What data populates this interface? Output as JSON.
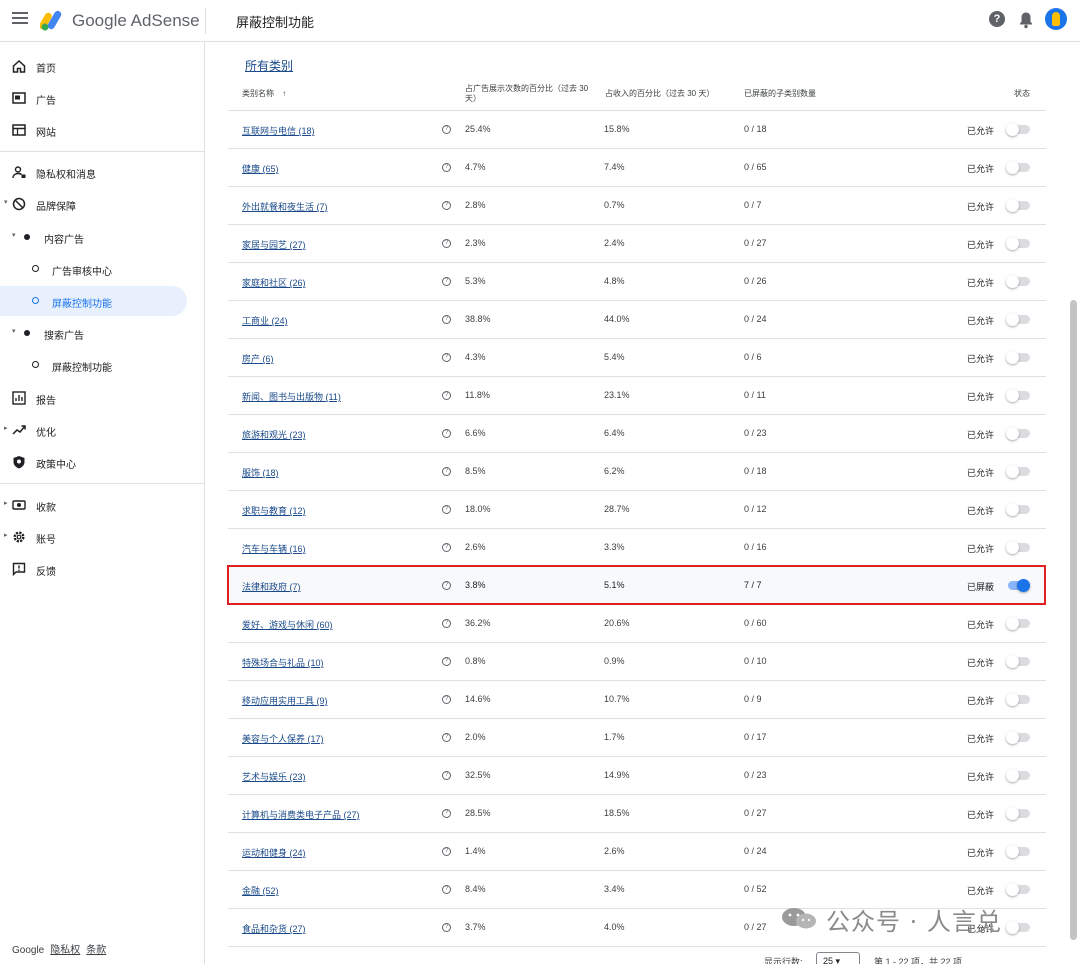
{
  "header": {
    "brand": "Google AdSense",
    "page_title": "屏蔽控制功能",
    "help_glyph": "?"
  },
  "sidebar": {
    "items": [
      {
        "label": "首页",
        "icon": "home-icon"
      },
      {
        "label": "广告",
        "icon": "ads-icon"
      },
      {
        "label": "网站",
        "icon": "sites-icon"
      },
      {
        "label": "隐私权和消息",
        "icon": "privacy-icon"
      },
      {
        "label": "品牌保障",
        "icon": "block-icon"
      },
      {
        "label": "内容广告"
      },
      {
        "label": "广告审核中心"
      },
      {
        "label": "屏蔽控制功能"
      },
      {
        "label": "搜索广告"
      },
      {
        "label": "屏蔽控制功能"
      },
      {
        "label": "报告",
        "icon": "report-icon"
      },
      {
        "label": "优化",
        "icon": "trend-icon"
      },
      {
        "label": "政策中心",
        "icon": "policy-icon"
      },
      {
        "label": "收款",
        "icon": "payments-icon"
      },
      {
        "label": "账号",
        "icon": "gear-icon"
      },
      {
        "label": "反馈",
        "icon": "feedback-icon"
      }
    ],
    "footer": {
      "google": "Google",
      "privacy": "隐私权",
      "terms": "条款"
    }
  },
  "main": {
    "all_categories": "所有类别",
    "columns": {
      "name": "类别名称",
      "sort_glyph": "↑",
      "impressions": "占广告展示次数的百分比（过去 30 天）",
      "revenue": "占收入的百分比（过去 30 天）",
      "blocked_sub": "已屏蔽的子类别数量",
      "status": "状态"
    },
    "rows": [
      {
        "name": "互联网与电信 (18)",
        "impr": "25.4%",
        "rev": "15.8%",
        "sub": "0 / 18",
        "status": "已允许"
      },
      {
        "name": "健康 (65)",
        "impr": "4.7%",
        "rev": "7.4%",
        "sub": "0 / 65",
        "status": "已允许"
      },
      {
        "name": "外出就餐和夜生活 (7)",
        "impr": "2.8%",
        "rev": "0.7%",
        "sub": "0 / 7",
        "status": "已允许"
      },
      {
        "name": "家居与园艺 (27)",
        "impr": "2.3%",
        "rev": "2.4%",
        "sub": "0 / 27",
        "status": "已允许"
      },
      {
        "name": "家庭和社区 (26)",
        "impr": "5.3%",
        "rev": "4.8%",
        "sub": "0 / 26",
        "status": "已允许"
      },
      {
        "name": "工商业 (24)",
        "impr": "38.8%",
        "rev": "44.0%",
        "sub": "0 / 24",
        "status": "已允许"
      },
      {
        "name": "房产 (6)",
        "impr": "4.3%",
        "rev": "5.4%",
        "sub": "0 / 6",
        "status": "已允许"
      },
      {
        "name": "新闻、图书与出版物 (11)",
        "impr": "11.8%",
        "rev": "23.1%",
        "sub": "0 / 11",
        "status": "已允许"
      },
      {
        "name": "旅游和观光 (23)",
        "impr": "6.6%",
        "rev": "6.4%",
        "sub": "0 / 23",
        "status": "已允许"
      },
      {
        "name": "服饰 (18)",
        "impr": "8.5%",
        "rev": "6.2%",
        "sub": "0 / 18",
        "status": "已允许"
      },
      {
        "name": "求职与教育 (12)",
        "impr": "18.0%",
        "rev": "28.7%",
        "sub": "0 / 12",
        "status": "已允许"
      },
      {
        "name": "汽车与车辆 (16)",
        "impr": "2.6%",
        "rev": "3.3%",
        "sub": "0 / 16",
        "status": "已允许"
      },
      {
        "name": "法律和政府 (7)",
        "impr": "3.8%",
        "rev": "5.1%",
        "sub": "7 / 7",
        "status": "已屏蔽"
      },
      {
        "name": "爱好、游戏与休闲 (60)",
        "impr": "36.2%",
        "rev": "20.6%",
        "sub": "0 / 60",
        "status": "已允许"
      },
      {
        "name": "特殊场合与礼品 (10)",
        "impr": "0.8%",
        "rev": "0.9%",
        "sub": "0 / 10",
        "status": "已允许"
      },
      {
        "name": "移动应用实用工具 (9)",
        "impr": "14.6%",
        "rev": "10.7%",
        "sub": "0 / 9",
        "status": "已允许"
      },
      {
        "name": "美容与个人保养 (17)",
        "impr": "2.0%",
        "rev": "1.7%",
        "sub": "0 / 17",
        "status": "已允许"
      },
      {
        "name": "艺术与娱乐 (23)",
        "impr": "32.5%",
        "rev": "14.9%",
        "sub": "0 / 23",
        "status": "已允许"
      },
      {
        "name": "计算机与消费类电子产品 (27)",
        "impr": "28.5%",
        "rev": "18.5%",
        "sub": "0 / 27",
        "status": "已允许"
      },
      {
        "name": "运动和健身 (24)",
        "impr": "1.4%",
        "rev": "2.6%",
        "sub": "0 / 24",
        "status": "已允许"
      },
      {
        "name": "金融 (52)",
        "impr": "8.4%",
        "rev": "3.4%",
        "sub": "0 / 52",
        "status": "已允许"
      },
      {
        "name": "食品和杂货 (27)",
        "impr": "3.7%",
        "rev": "4.0%",
        "sub": "0 / 27",
        "status": "已允许"
      }
    ],
    "pagination": {
      "rows_label": "显示行数:",
      "rows_value": "25",
      "range": "第 1 - 22 项，共 22 项"
    }
  },
  "watermark": "公众号 · 人言兑",
  "colors": {
    "accent": "#1a73e8",
    "highlight_border": "#e02020"
  }
}
